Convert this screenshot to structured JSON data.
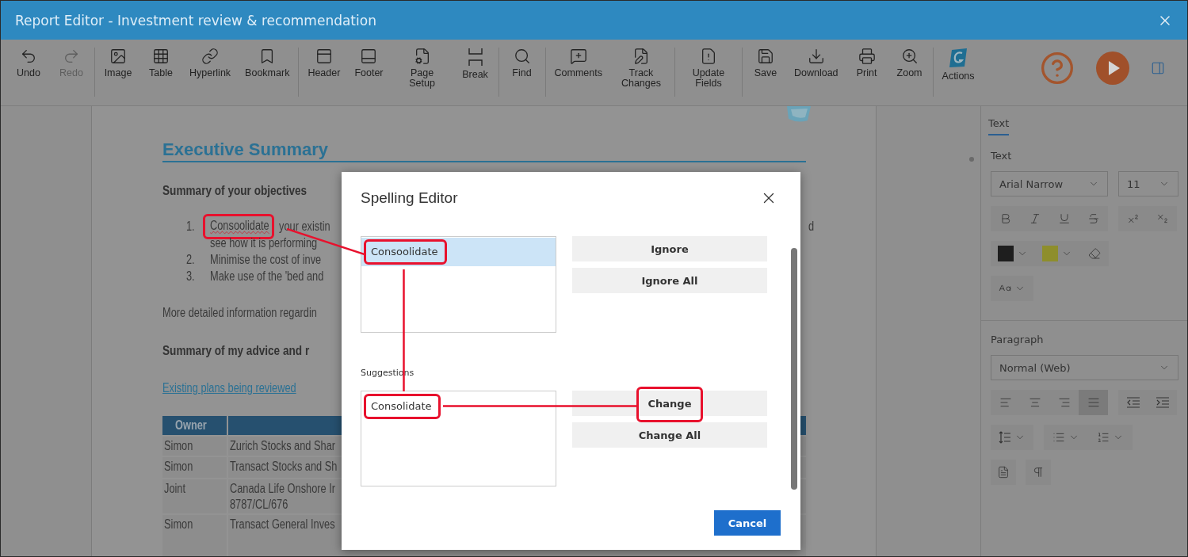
{
  "window": {
    "title": "Report Editor - Investment review & recommendation"
  },
  "toolbar": {
    "groups": [
      [
        {
          "label": "Undo",
          "disabled": false
        },
        {
          "label": "Redo",
          "disabled": true
        }
      ],
      [
        {
          "label": "Image",
          "disabled": false
        },
        {
          "label": "Table",
          "disabled": false
        },
        {
          "label": "Hyperlink",
          "disabled": false
        },
        {
          "label": "Bookmark",
          "disabled": false
        }
      ],
      [
        {
          "label": "Header",
          "disabled": false
        },
        {
          "label": "Footer",
          "disabled": false
        },
        {
          "label": "Page Setup",
          "disabled": false
        },
        {
          "label": "Break",
          "disabled": false
        }
      ],
      [
        {
          "label": "Find",
          "disabled": false
        }
      ],
      [
        {
          "label": "Comments",
          "disabled": false
        },
        {
          "label": "Track Changes",
          "disabled": false
        }
      ],
      [
        {
          "label": "Update Fields",
          "disabled": false
        }
      ],
      [
        {
          "label": "Save",
          "disabled": false
        },
        {
          "label": "Download",
          "disabled": false
        },
        {
          "label": "Print",
          "disabled": false
        },
        {
          "label": "Zoom",
          "disabled": false
        }
      ],
      [
        {
          "label": "Actions",
          "disabled": false
        }
      ]
    ]
  },
  "document": {
    "heading": "Executive Summary",
    "objectives_title": "Summary of your objectives",
    "objectives": [
      {
        "number": "1.",
        "misspelled": "Consoolidate",
        "highlighted": true,
        "text": "your existin",
        "tail": "d",
        "continuation": "see how it is performing"
      },
      {
        "number": "2.",
        "text": "Minimise the cost of inve"
      },
      {
        "number": "3.",
        "text": "Make use of the 'bed and"
      }
    ],
    "detail_text": "More detailed information regardin",
    "advice_title": "Summary of my advice and r",
    "link": "Existing plans being reviewed",
    "table": {
      "columns": [
        "Owner"
      ],
      "rows": [
        [
          "Simon",
          "Zurich Stocks and Shar"
        ],
        [
          "Simon",
          "Transact Stocks and Sh"
        ],
        [
          "Joint",
          "Canada Life Onshore Ir\n8787/CL/676"
        ],
        [
          "Simon",
          "Transact General Inves"
        ]
      ]
    }
  },
  "side_panel": {
    "tabs": [
      {
        "label": "Text",
        "selected": true
      }
    ],
    "text_title": "Text",
    "font": "Arial Narrow",
    "size": "11",
    "colors": [
      {
        "color": "#1e1e1e"
      },
      {
        "color": "#8e8e2c"
      }
    ],
    "paragraph_title": "Paragraph",
    "style": "Normal (Web)",
    "alignment": [
      {
        "selected": false
      },
      {
        "selected": false
      },
      {
        "selected": false
      },
      {
        "selected": true
      }
    ]
  },
  "dialog": {
    "title": "Spelling Editor",
    "words": [
      {
        "text": "Consoolidate",
        "selected": true,
        "highlighted": true
      }
    ],
    "actions": [
      {
        "label": "Ignore",
        "highlighted": false
      },
      {
        "label": "Ignore All",
        "highlighted": false
      }
    ],
    "suggestions_label": "Suggestions",
    "suggestions": [
      {
        "text": "Consolidate",
        "selected": false,
        "highlighted": true
      }
    ],
    "change_actions": [
      {
        "label": "Change",
        "highlighted": true
      },
      {
        "label": "Change All",
        "highlighted": false
      }
    ],
    "cancel": "Cancel"
  }
}
